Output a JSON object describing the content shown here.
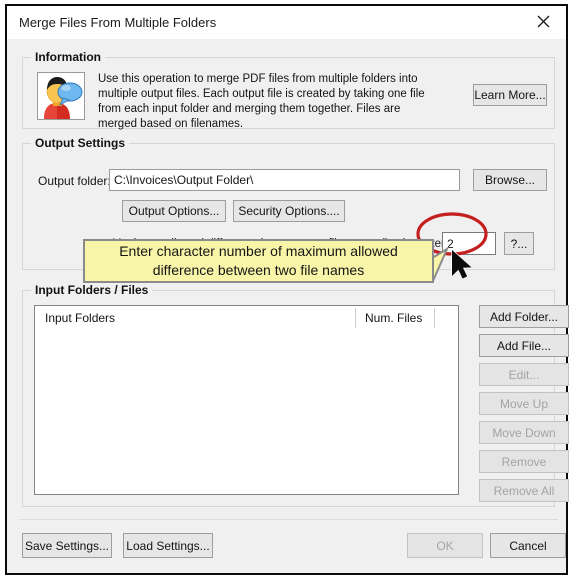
{
  "window": {
    "title": "Merge Files From Multiple Folders",
    "close_icon": "close-icon"
  },
  "information": {
    "group_title": "Information",
    "icon": "user-speech-bubble-icon",
    "text": "Use this operation to merge PDF files from multiple folders into multiple output files. Each output file is created by taking one file from each input folder and merging them together. Files are merged based on filenames.",
    "learn_more_label": "Learn More..."
  },
  "output_settings": {
    "group_title": "Output Settings",
    "output_folder_label": "Output folder:",
    "output_folder_value": "C:\\Invoices\\Output Folder\\",
    "output_folder_placeholder": "",
    "browse_label": "Browse...",
    "output_options_label": "Output Options...",
    "security_options_label": "Security Options....",
    "max_diff_label": "Maximum allowed difference between two filenames (in characters):",
    "max_diff_value": "2",
    "max_diff_placeholder": "",
    "max_diff_help_label": "?..."
  },
  "input_folders": {
    "group_title": "Input Folders / Files",
    "columns": [
      "Input Folders",
      "Num. Files"
    ],
    "rows": [],
    "buttons": [
      {
        "label": "Add Folder...",
        "enabled": true
      },
      {
        "label": "Add File...",
        "enabled": true
      },
      {
        "label": "Edit...",
        "enabled": false
      },
      {
        "label": "Move Up",
        "enabled": false
      },
      {
        "label": "Move Down",
        "enabled": false
      },
      {
        "label": "Remove",
        "enabled": false
      },
      {
        "label": "Remove All",
        "enabled": false
      }
    ]
  },
  "footer": {
    "save_settings_label": "Save Settings...",
    "load_settings_label": "Load Settings...",
    "ok_label": "OK",
    "ok_enabled": false,
    "cancel_label": "Cancel"
  },
  "annotation": {
    "callout_line1": "Enter character number of maximum allowed",
    "callout_line2": "difference between two file names",
    "callout_bg_color": "#f8f4a8",
    "highlight_color": "#c42020",
    "highlight_shape": "ellipse",
    "cursor_icon": "mouse-pointer-icon"
  }
}
